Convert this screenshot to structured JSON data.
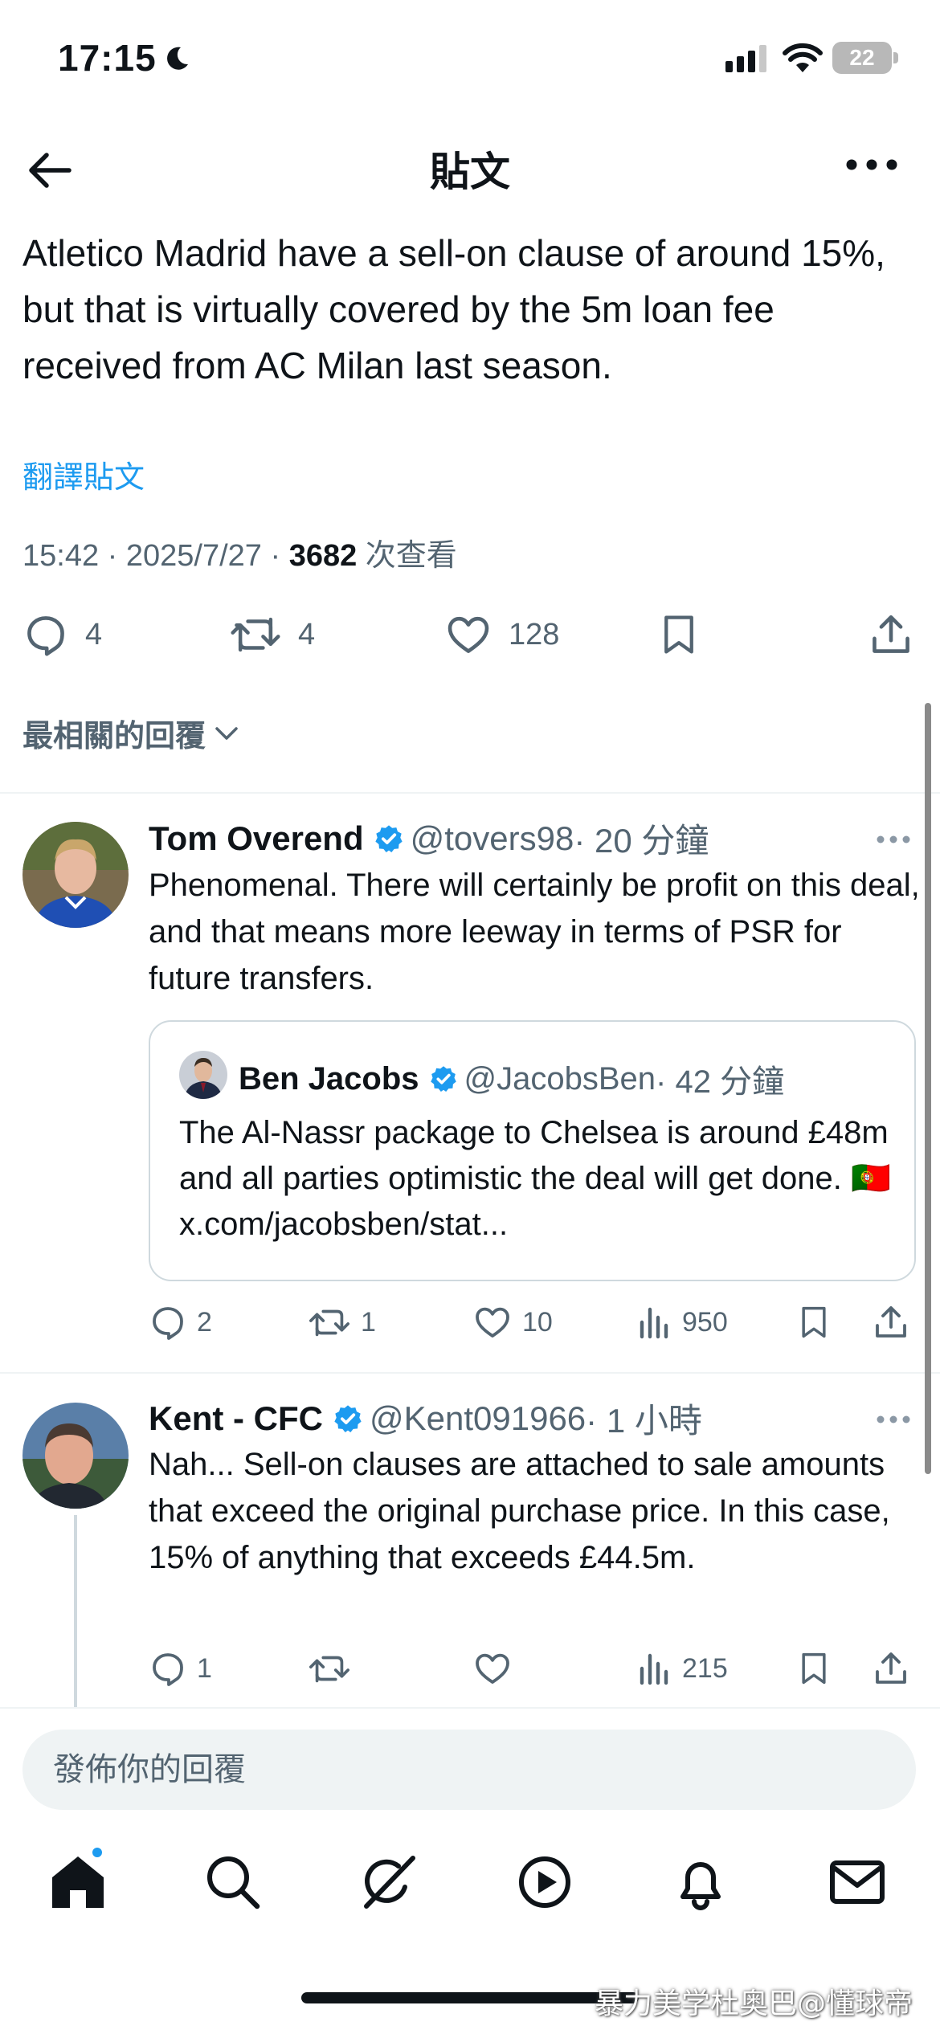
{
  "status_bar": {
    "time": "17:15",
    "battery": "22"
  },
  "nav": {
    "title": "貼文"
  },
  "tweet": {
    "text": "Atletico Madrid have a sell-on clause of around 15%, but that is virtually covered by the 5m loan fee received from AC Milan last season.",
    "translate_label": "翻譯貼文",
    "timestamp": "15:42 · 2025/7/27 · ",
    "views": "3682",
    "views_label": " 次查看",
    "replies": "4",
    "reposts": "4",
    "likes": "128"
  },
  "sort_label": "最相關的回覆",
  "replies": [
    {
      "name": "Tom Overend",
      "handle": "@tovers98",
      "time": " · 20 分鐘",
      "text": "Phenomenal. There will certainly be profit on this deal, and that means more leeway in terms of PSR for future transfers.",
      "quote": {
        "name": "Ben Jacobs",
        "handle": "@JacobsBen",
        "time": " · 42 分鐘",
        "text": "The Al-Nassr package to Chelsea is around £48m and all parties optimistic the deal will get done. 🇵🇹 x.com/jacobsben/stat..."
      },
      "replies": "2",
      "reposts": "1",
      "likes": "10",
      "views": "950"
    },
    {
      "name": "Kent - CFC",
      "handle": "@Kent091966",
      "time": " · 1 小時",
      "text": "Nah... Sell-on clauses are attached to sale amounts that exceed the original purchase price. In this case, 15% of anything that exceeds £44.5m.",
      "replies": "1",
      "reposts": "",
      "likes": "",
      "views": "215"
    }
  ],
  "reply_placeholder": "發佈你的回覆",
  "watermark": "暴力美学杜奥巴@懂球帝",
  "colors": {
    "accent": "#1d9bf0",
    "text": "#0f1419",
    "secondary": "#536471",
    "border": "#cfd9de"
  },
  "icons": [
    "back-arrow-icon",
    "more-icon",
    "reply-icon",
    "repost-icon",
    "like-icon",
    "bookmark-icon",
    "share-icon",
    "views-icon",
    "verified-icon",
    "home-icon",
    "search-icon",
    "grok-icon",
    "video-icon",
    "bell-icon",
    "mail-icon"
  ]
}
